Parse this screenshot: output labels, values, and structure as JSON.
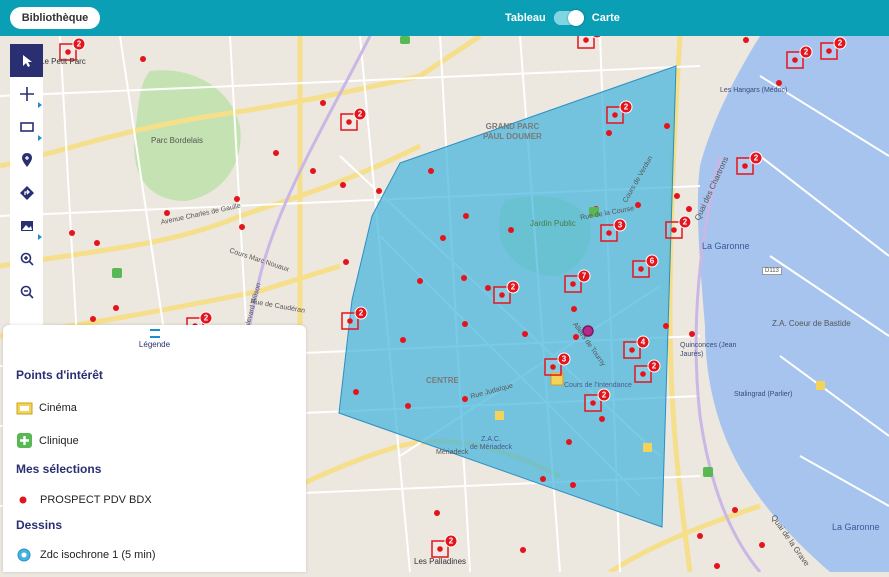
{
  "header": {
    "library_label": "Bibliothèque",
    "toggle_left": "Tableau",
    "toggle_right": "Carte",
    "toggle_active": "Carte"
  },
  "toolbar": {
    "tools": [
      "select-icon",
      "crosshair-icon",
      "rectangle-icon",
      "add-pin-icon",
      "route-icon",
      "image-icon",
      "zoom-in-icon",
      "zoom-out-icon"
    ]
  },
  "legend": {
    "title": "Légende",
    "poi_section": "Points d'intérêt",
    "poi_items": [
      "Cinéma",
      "Clinique"
    ],
    "selection_section": "Mes sélections",
    "selection_item": "PROSPECT PDV BDX",
    "drawings_section": "Dessins",
    "drawing_item": "Zdc isochrone 1 (5 min)"
  },
  "map": {
    "labels": {
      "grand_parc": "GRAND PARC\nPAUL DOUMER",
      "parc_bordelais": "Parc Bordelais",
      "jardin_public": "Jardin Public",
      "la_garonne_1": "La Garonne",
      "la_garonne_2": "La Garonne",
      "centre": "CENTRE",
      "za_coeur_de_bastide": "Z.A. Coeur de Bastide",
      "les_hangars": "Les Hangars (Médoc)",
      "stalingrad": "Stalingrad (Parlier)",
      "quinconces": "Quinconces (Jean\nJaurès)",
      "le_petit_parc": "Le Petit Parc",
      "les_palladines": "Les Palladines",
      "meriadeck": "Mériadeck",
      "cours_de_l_intendance": "Cours de l'Intendance",
      "zac_quartier": "Z.A.C.\nde Mériadeck",
      "d113": "D113",
      "cours_de_gaulle": "Avenue Charles de Gaulle",
      "cours_marc_nouaux": "Cours Marc Nouaux",
      "rue_de_caudéran": "Rue de Caudéran",
      "boulevard_wilson": "Boulevard Wilson",
      "cours_de_verdun": "Cours de Verdun",
      "allees_tourny": "Allées de Tourny",
      "quai_de_la_grave": "Quai de la Grave",
      "quai_des_chartrons": "Quai des Chartrons",
      "rue_judaique": "Rue Judaïque",
      "rue_de_la_course": "Rue de la Course",
      "cours_de_l_intendance_road": "Cours de l'Intendance"
    },
    "cluster_counts": [
      "2",
      "2",
      "2",
      "2",
      "2",
      "2",
      "3",
      "6",
      "2",
      "7",
      "2",
      "2",
      "4",
      "2",
      "2",
      "3",
      "2",
      "2",
      "2"
    ],
    "colors": {
      "topbar": "#0a9fb5",
      "isochrone_fill": "#44b6de",
      "isochrone_stroke": "#2a8fc4",
      "point": "#e4141d",
      "river": "#a6c4ee",
      "park": "#c4e2b2",
      "nav": "#2a2f72"
    }
  }
}
